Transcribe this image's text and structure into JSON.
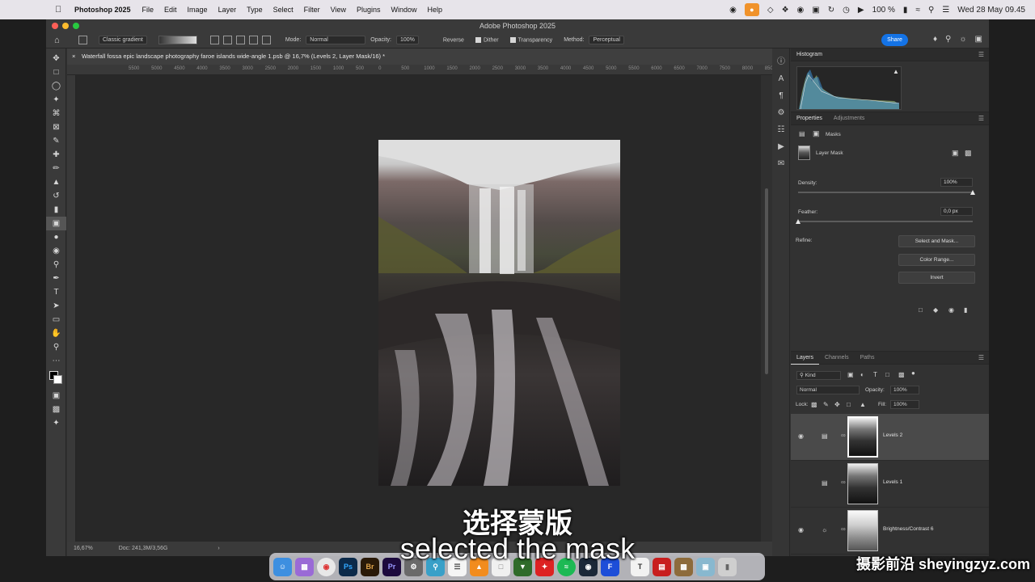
{
  "menubar": {
    "apple": "",
    "app_name": "Photoshop 2025",
    "items": [
      "File",
      "Edit",
      "Image",
      "Layer",
      "Type",
      "Select",
      "Filter",
      "View",
      "Plugins",
      "Window",
      "Help"
    ],
    "battery": "100 %",
    "clock": "Wed 28 May  09.45"
  },
  "window": {
    "title": "Adobe Photoshop 2025"
  },
  "options": {
    "gradient_preset": "Classic gradient",
    "mode_label": "Mode:",
    "mode_value": "Normal",
    "opacity_label": "Opacity:",
    "opacity_value": "100%",
    "reverse": "Reverse",
    "dither": "Dither",
    "transparency": "Transparency",
    "method_label": "Method:",
    "method_value": "Perceptual",
    "share": "Share"
  },
  "document": {
    "tab_title": "Waterfall fossa epic landscape photography faroe islands wide-angle 1.psb @ 16,7% (Levels 2, Layer Mask/16) *",
    "ruler_labels": [
      "5500",
      "5000",
      "4500",
      "4000",
      "3500",
      "3000",
      "2500",
      "2000",
      "1500",
      "1000",
      "500",
      "0",
      "500",
      "1000",
      "1500",
      "2000",
      "2500",
      "3000",
      "3500",
      "4000",
      "4500",
      "5000",
      "5500",
      "6000",
      "6500",
      "7000",
      "7500",
      "8000",
      "8500",
      "9000"
    ],
    "zoom": "16,67%",
    "doc_size": "Doc: 241,3M/3,56G"
  },
  "panels": {
    "histogram": {
      "title": "Histogram"
    },
    "properties": {
      "tab_properties": "Properties",
      "tab_adjustments": "Adjustments",
      "masks": "Masks",
      "layer_mask": "Layer Mask",
      "density_label": "Density:",
      "density_value": "100%",
      "density_level": 1.0,
      "feather_label": "Feather:",
      "feather_value": "0,0 px",
      "feather_level": 0.0,
      "refine_label": "Refine:",
      "select_and_mask": "Select and Mask...",
      "color_range": "Color Range...",
      "invert": "Invert"
    },
    "layers": {
      "tab_layers": "Layers",
      "tab_channels": "Channels",
      "tab_paths": "Paths",
      "kind": "Kind",
      "blend_mode": "Normal",
      "opacity_label": "Opacity:",
      "opacity_value": "100%",
      "lock_label": "Lock:",
      "fill_label": "Fill:",
      "fill_value": "100%",
      "rows": [
        {
          "name": "Levels 2",
          "active": true,
          "visible": true
        },
        {
          "name": "Levels 1",
          "active": false,
          "visible": false
        },
        {
          "name": "Brightness/Contrast 6",
          "active": false,
          "visible": true
        }
      ]
    }
  },
  "subtitles": {
    "zh": "选择蒙版",
    "en": "selected the mask"
  },
  "watermark": "摄影前沿 sheyingzyz.com",
  "colors": {
    "accent": "#1473e6",
    "mic": "#f0922b",
    "foreground": "#000000",
    "background": "#ffffff"
  }
}
